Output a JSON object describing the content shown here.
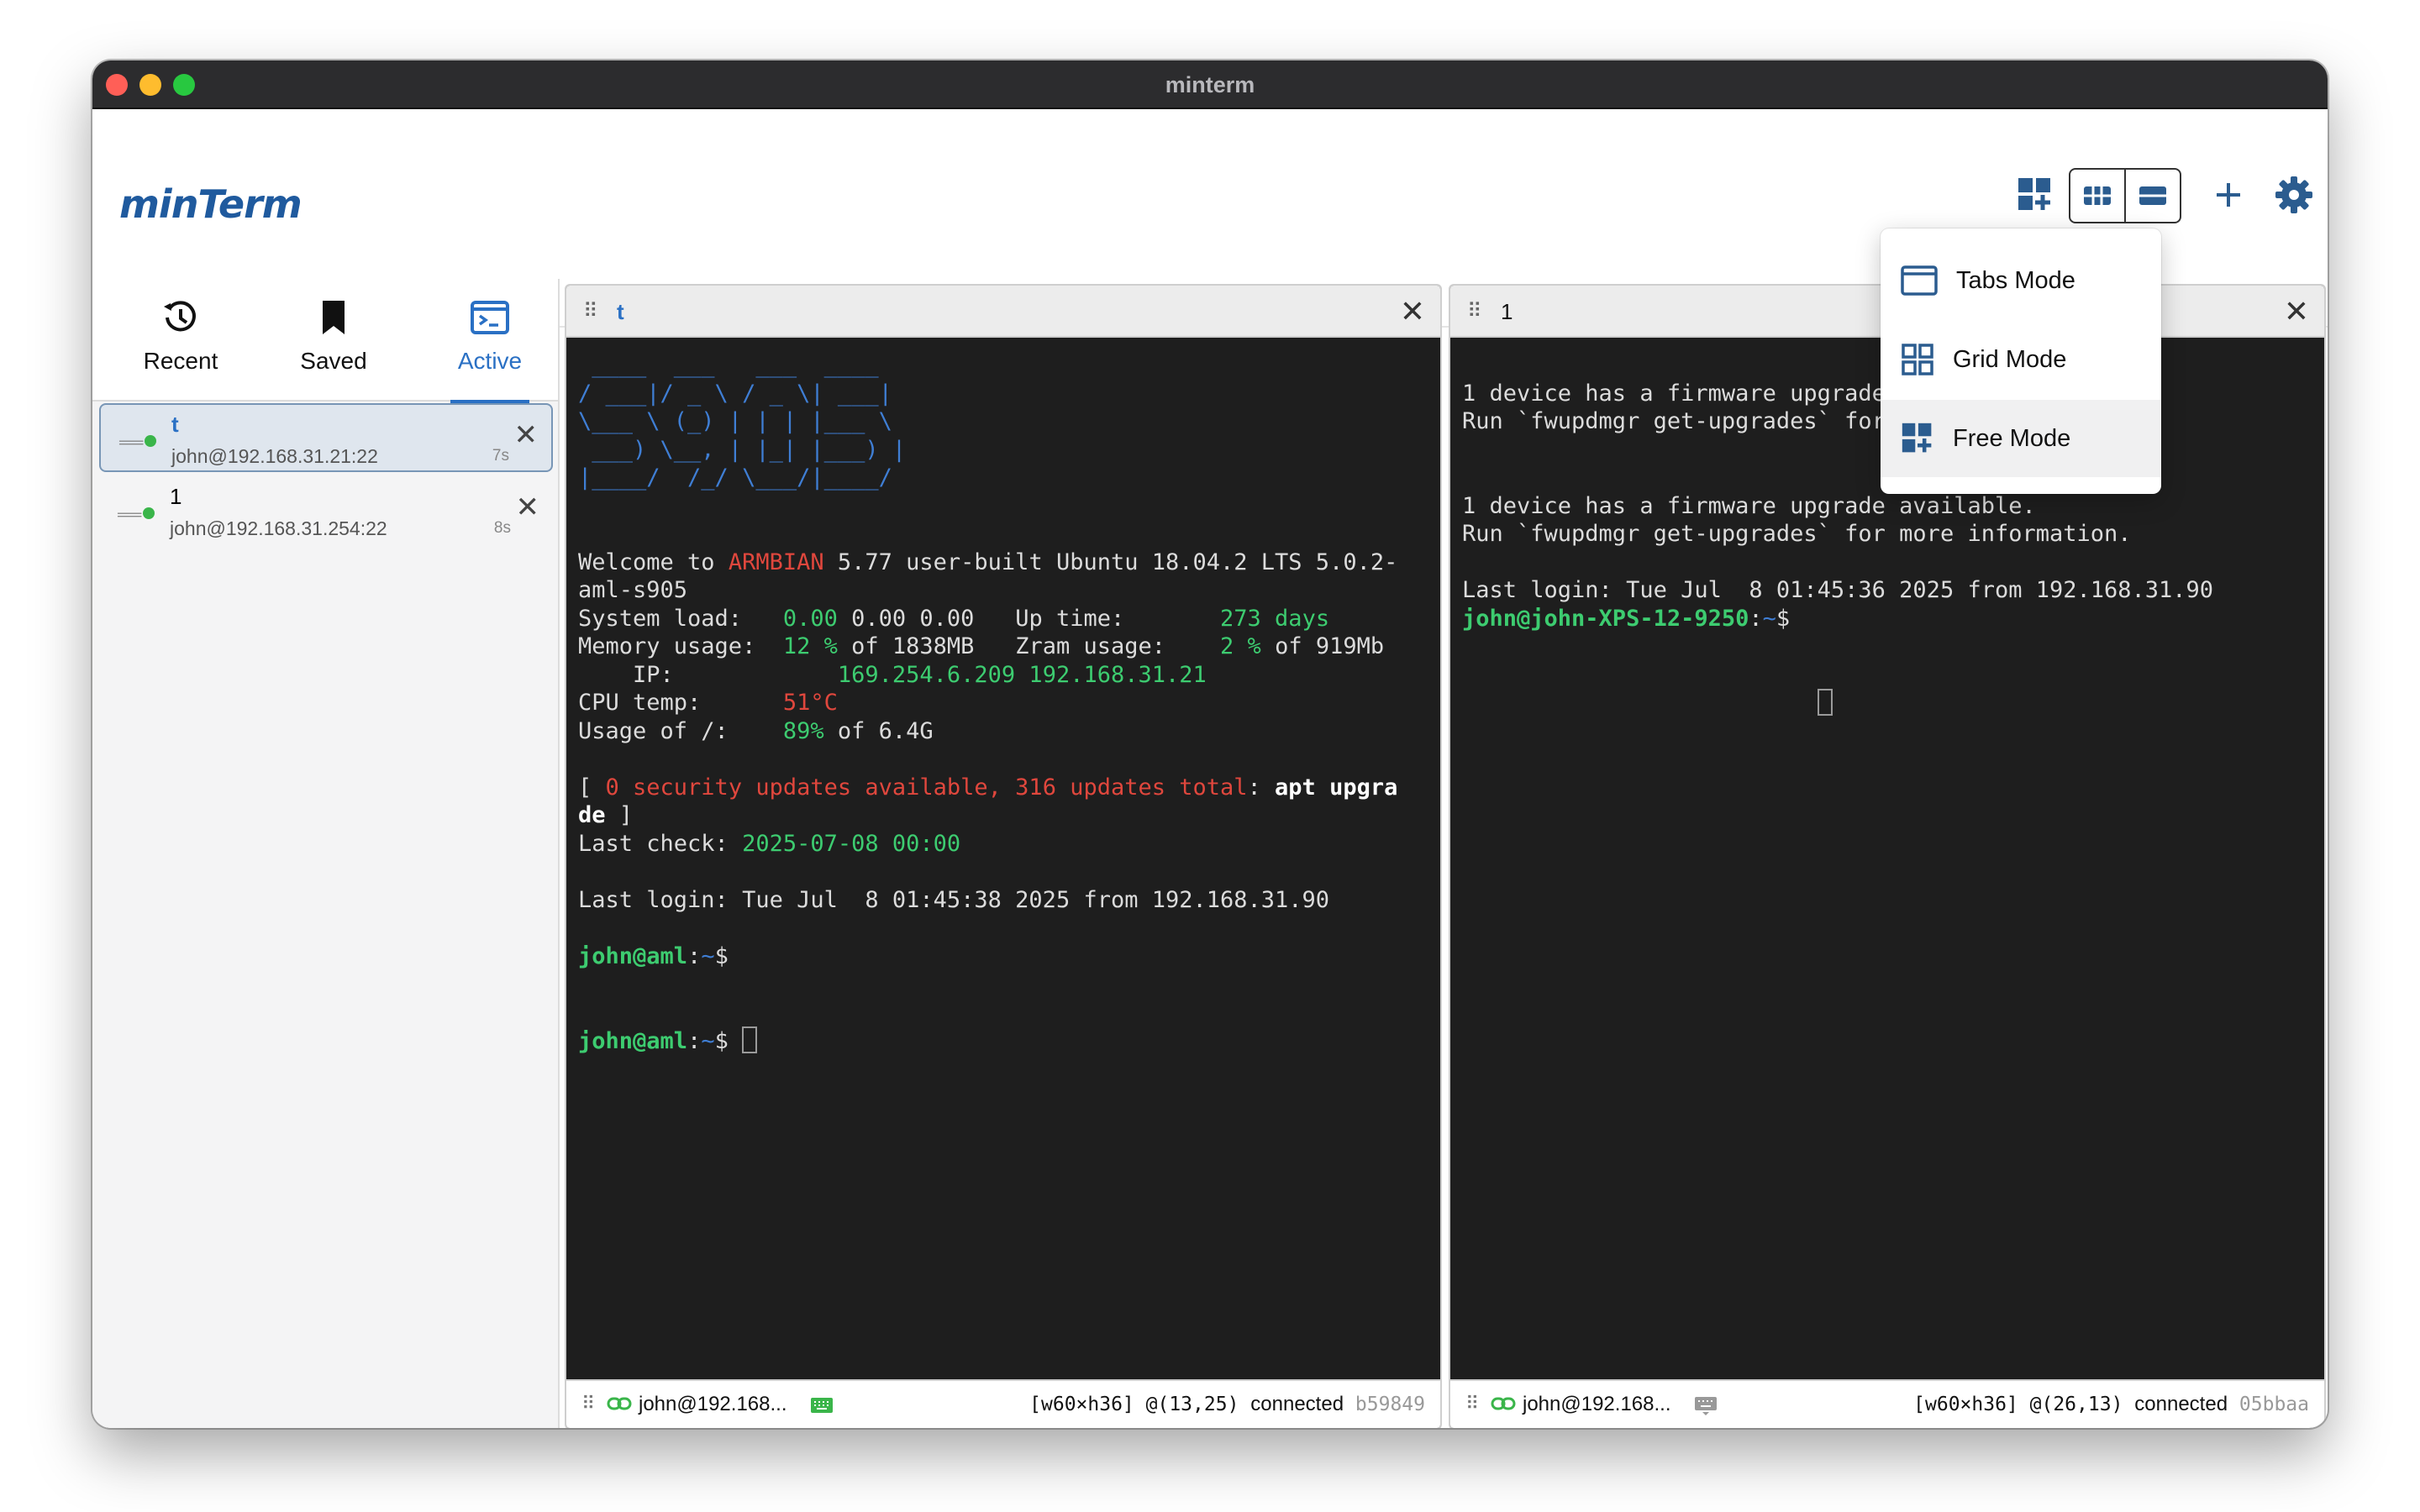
{
  "window": {
    "title": "minterm"
  },
  "app": {
    "logo": "minTerm"
  },
  "tabs": [
    {
      "label": "t",
      "close": "✕"
    },
    {
      "label": "1",
      "close": "✕"
    }
  ],
  "sidebar": {
    "tabs": [
      {
        "label": "Recent",
        "icon": "history-icon"
      },
      {
        "label": "Saved",
        "icon": "bookmark-icon"
      },
      {
        "label": "Active",
        "icon": "terminal-icon"
      }
    ],
    "sessions": [
      {
        "name": "t",
        "address": "john@192.168.31.21:22",
        "age": "7s"
      },
      {
        "name": "1",
        "address": "john@192.168.31.254:22",
        "age": "8s"
      }
    ]
  },
  "mode_menu": {
    "items": [
      {
        "label": "Tabs Mode",
        "icon": "tabs-mode-icon"
      },
      {
        "label": "Grid Mode",
        "icon": "grid-mode-icon"
      },
      {
        "label": "Free Mode",
        "icon": "free-mode-icon"
      }
    ]
  },
  "panes": [
    {
      "title": "t",
      "terminal": {
        "banner": [
          " ____  ___   ___  ____",
          "/ ___|/ _ \\ / _ \\| ___|",
          "\\___ \\ (_) | | | |___ \\",
          " ___) \\__, | |_| |___) |",
          "|____/  /_/ \\___/|____/"
        ],
        "welcome_pre": "Welcome to ",
        "welcome_brand": "ARMBIAN",
        "welcome_post": " 5.77 user-built Ubuntu 18.04.2 LTS 5.0.2-",
        "welcome_cont": "aml-s905",
        "sysload_label": "System load:   ",
        "sysload_val": "0.00",
        "sysload_rest": " 0.00 0.00   Up time:       ",
        "uptime_val": "273 days",
        "mem_label": "Memory usage:  ",
        "mem_val": "12 %",
        "mem_rest": " of 1838MB   Zram usage:    ",
        "zram_val": "2 %",
        "zram_rest": " of 919Mb",
        "ip_label": "    IP:            ",
        "ip_val": "169.254.6.209 192.168.31.21",
        "cpu_label": "CPU temp:      ",
        "cpu_val": "51°C",
        "usage_label": "Usage of /:    ",
        "usage_val": "89%",
        "usage_rest": " of 6.4G",
        "upd_open": "[ ",
        "upd_red": "0 security updates available, 316 updates total",
        "upd_colon": ": ",
        "upd_cmd": "apt upgra",
        "upd_cont": "de",
        "upd_close": " ]",
        "lastcheck_label": "Last check: ",
        "lastcheck_val": "2025-07-08 00:00",
        "lastlogin": "Last login: Tue Jul  8 01:45:38 2025 from 192.168.31.90",
        "prompt_user": "john@aml",
        "prompt_colon": ":",
        "prompt_tilde": "~",
        "prompt_dollar": "$ "
      },
      "footer": {
        "user": "john@192.168...",
        "size": "[w60×h36]",
        "pos": "@(13,25)",
        "state": "connected",
        "hash": "b59849"
      }
    },
    {
      "title": "1",
      "terminal": {
        "fw1": "1 device has a firmware upgrade available.",
        "run1": "Run `fwupdmgr get-upgrades` for more information.",
        "fw2": "1 device has a firmware upgrade available.",
        "run2": "Run `fwupdmgr get-upgrades` for more information.",
        "lastlogin": "Last login: Tue Jul  8 01:45:36 2025 from 192.168.31.90",
        "prompt_user": "john@john-XPS-12-9250",
        "prompt_colon": ":",
        "prompt_tilde": "~",
        "prompt_dollar": "$"
      },
      "footer": {
        "user": "john@192.168...",
        "size": "[w60×h36]",
        "pos": "@(26,13)",
        "state": "connected",
        "hash": "05bbaa"
      }
    }
  ],
  "colors": {
    "accent": "#2a70c4",
    "terminal_bg": "#1e1e1e",
    "green": "#3dcc70",
    "red": "#e0473d"
  }
}
